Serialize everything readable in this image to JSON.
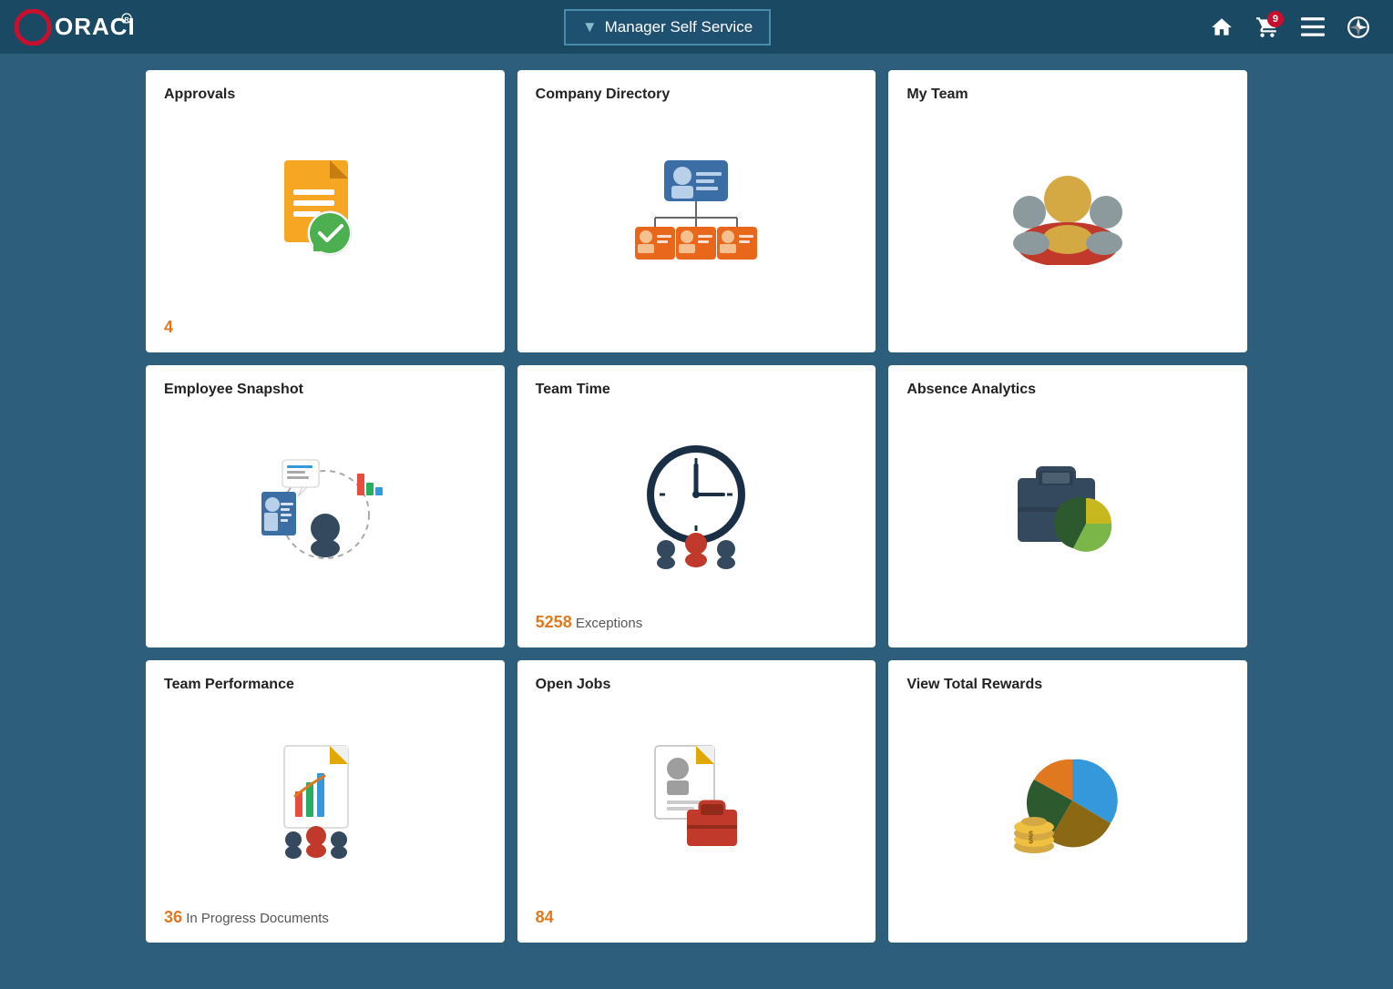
{
  "header": {
    "logo": "ORACLE",
    "nav_label": "Manager Self Service",
    "nav_arrow": "▼",
    "notification_count": "9",
    "icons": {
      "home": "home-icon",
      "cart": "cart-icon",
      "menu": "menu-icon",
      "compass": "compass-icon"
    }
  },
  "tiles": [
    {
      "id": "approvals",
      "title": "Approvals",
      "count": "4",
      "count_suffix": "",
      "icon": "approvals-icon"
    },
    {
      "id": "company-directory",
      "title": "Company Directory",
      "count": "",
      "count_suffix": "",
      "icon": "company-directory-icon"
    },
    {
      "id": "my-team",
      "title": "My Team",
      "count": "",
      "count_suffix": "",
      "icon": "my-team-icon"
    },
    {
      "id": "employee-snapshot",
      "title": "Employee Snapshot",
      "count": "",
      "count_suffix": "",
      "icon": "employee-snapshot-icon"
    },
    {
      "id": "team-time",
      "title": "Team Time",
      "count": "5258",
      "count_suffix": " Exceptions",
      "icon": "team-time-icon"
    },
    {
      "id": "absence-analytics",
      "title": "Absence Analytics",
      "count": "",
      "count_suffix": "",
      "icon": "absence-analytics-icon"
    },
    {
      "id": "team-performance",
      "title": "Team Performance",
      "count": "36",
      "count_suffix": " In Progress Documents",
      "icon": "team-performance-icon"
    },
    {
      "id": "open-jobs",
      "title": "Open Jobs",
      "count": "84",
      "count_suffix": "",
      "icon": "open-jobs-icon"
    },
    {
      "id": "view-total-rewards",
      "title": "View Total Rewards",
      "count": "",
      "count_suffix": "",
      "icon": "view-total-rewards-icon"
    }
  ]
}
